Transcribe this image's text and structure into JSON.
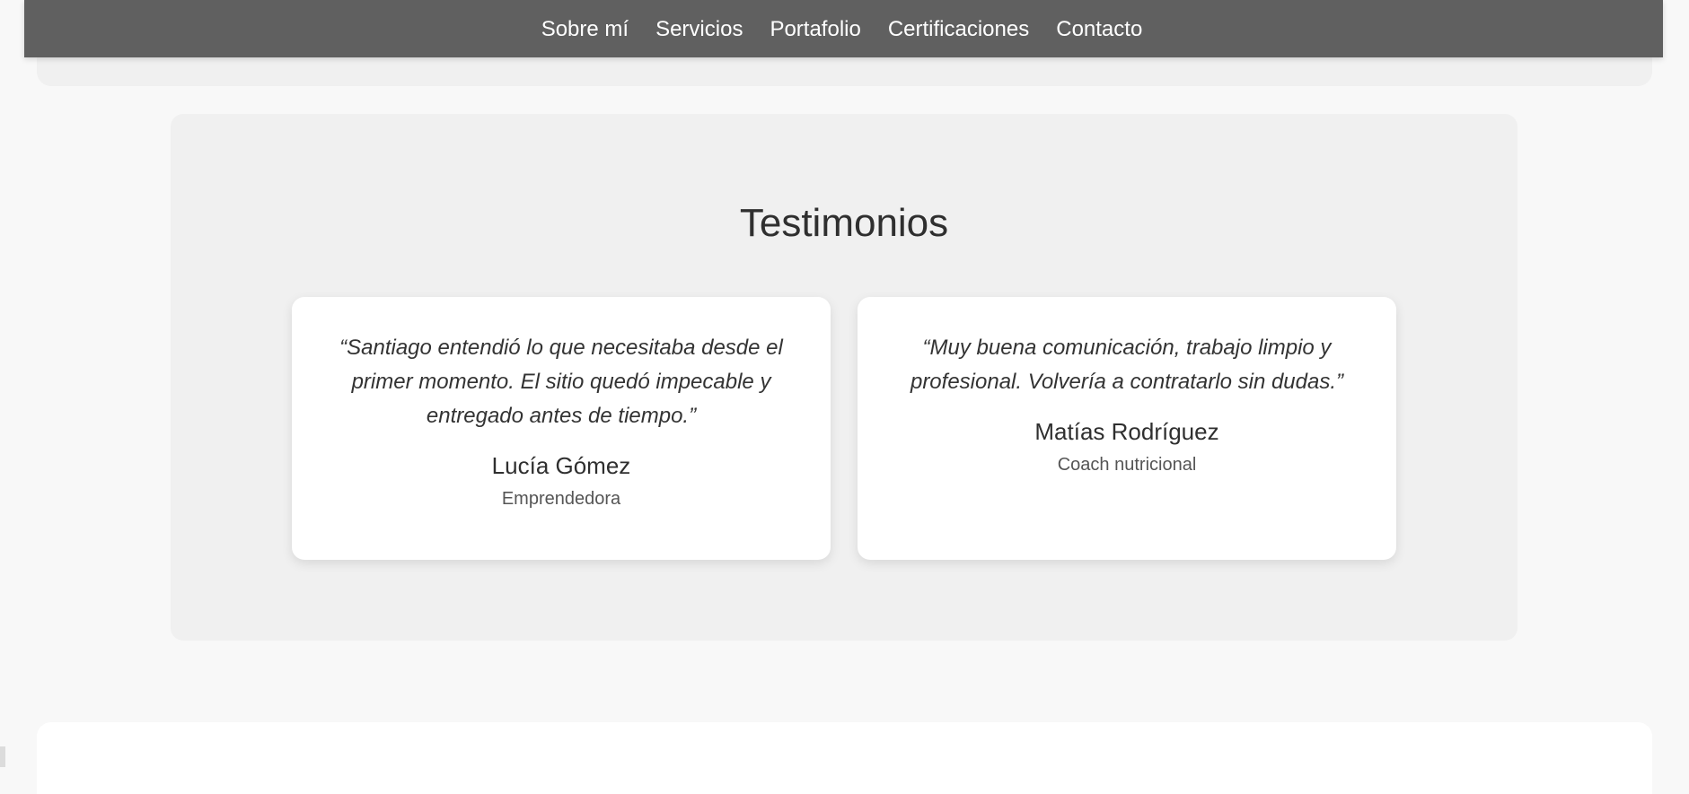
{
  "navigation": {
    "items": [
      {
        "label": "Sobre mí"
      },
      {
        "label": "Servicios"
      },
      {
        "label": "Portafolio"
      },
      {
        "label": "Certificaciones"
      },
      {
        "label": "Contacto"
      }
    ]
  },
  "testimonials": {
    "title": "Testimonios",
    "items": [
      {
        "quote": "“Santiago entendió lo que necesitaba desde el primer momento. El sitio quedó impecable y entregado antes de tiempo.”",
        "name": "Lucía Gómez",
        "role": "Emprendedora"
      },
      {
        "quote": "“Muy buena comunicación, trabajo limpio y profesional. Volvería a contratarlo sin dudas.”",
        "name": "Matías Rodríguez",
        "role": "Coach nutricional"
      }
    ]
  },
  "colors": {
    "page_background": "#f8f8f8",
    "navbar_background": "#606060",
    "section_background": "#f0f0f0",
    "card_background": "#ffffff",
    "text_primary": "#2f2f2f",
    "text_secondary": "#555555"
  }
}
